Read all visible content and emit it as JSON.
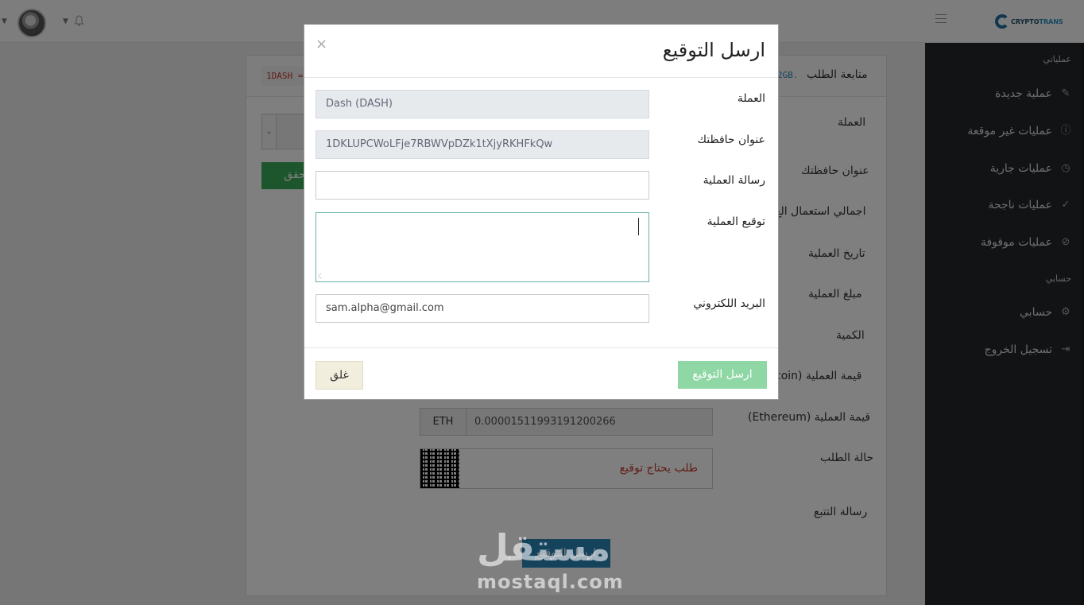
{
  "topbar": {
    "logo_text_a": "CRYPTO",
    "logo_text_b": "TRANS"
  },
  "sidebar": {
    "section_ops": "عملياتي",
    "items": [
      {
        "label": "عملية جديدة",
        "icon": "edit-icon"
      },
      {
        "label": "عمليات غير موقعة",
        "icon": "info-icon"
      },
      {
        "label": "عمليات جارية",
        "icon": "clock-icon"
      },
      {
        "label": "عمليات ناجحة",
        "icon": "check-icon"
      },
      {
        "label": "عمليات موقوفة",
        "icon": "block-icon"
      }
    ],
    "section_account": "حسابي",
    "account_items": [
      {
        "label": "حسابي",
        "icon": "gear-icon"
      },
      {
        "label": "تسجيل الخروج",
        "icon": "logout-icon"
      }
    ]
  },
  "background": {
    "header_title": "متابعة الطلب",
    "header_code_left": "1DASH =",
    "header_code_right": "2GB.",
    "labels": {
      "currency": "العملة",
      "wallet": "عنوان حافظتك",
      "total_usage": "اجمالي استعمال الع",
      "op_date": "تاريخ العملية",
      "op_amount": "مبلغ العملية",
      "quantity": "الكمية",
      "value_bitcoin": "قيمة العملية (coin",
      "value_eth": "قيمة العملية (Ethereum)",
      "status": "حالة الطلب",
      "tracking_msg": "رسالة التتبع"
    },
    "verify_button": "تحقق",
    "eth_addon": "ETH",
    "eth_value": "0.00001511993191200266",
    "status_text": "طلب يحتاج توقيع",
    "send_button": "ارسل التوقيع"
  },
  "modal": {
    "title": "ارسل التوقيع",
    "close_symbol": "×",
    "fields": {
      "currency_label": "العملة",
      "currency_value": "Dash (DASH)",
      "wallet_label": "عنوان حافظتك",
      "wallet_value": "1DKLUPCWoLFje7RBWVpDZk1tXjyRKHFkQw",
      "message_label": "رسالة العملية",
      "message_value": "",
      "signature_label": "توقيع العملية",
      "email_label": "البريد اللكتروني",
      "email_value": "sam.alpha@gmail.com"
    },
    "close_button": "غلق",
    "send_button": "ارسل التوقيع"
  },
  "watermark": {
    "arabic": "مستقل",
    "latin": "mostaql.com"
  },
  "colors": {
    "sidebar_bg": "#23262b",
    "send_green": "#8fd7a4",
    "brand_blue": "#1f6f9a",
    "status_red": "#c0392b"
  }
}
